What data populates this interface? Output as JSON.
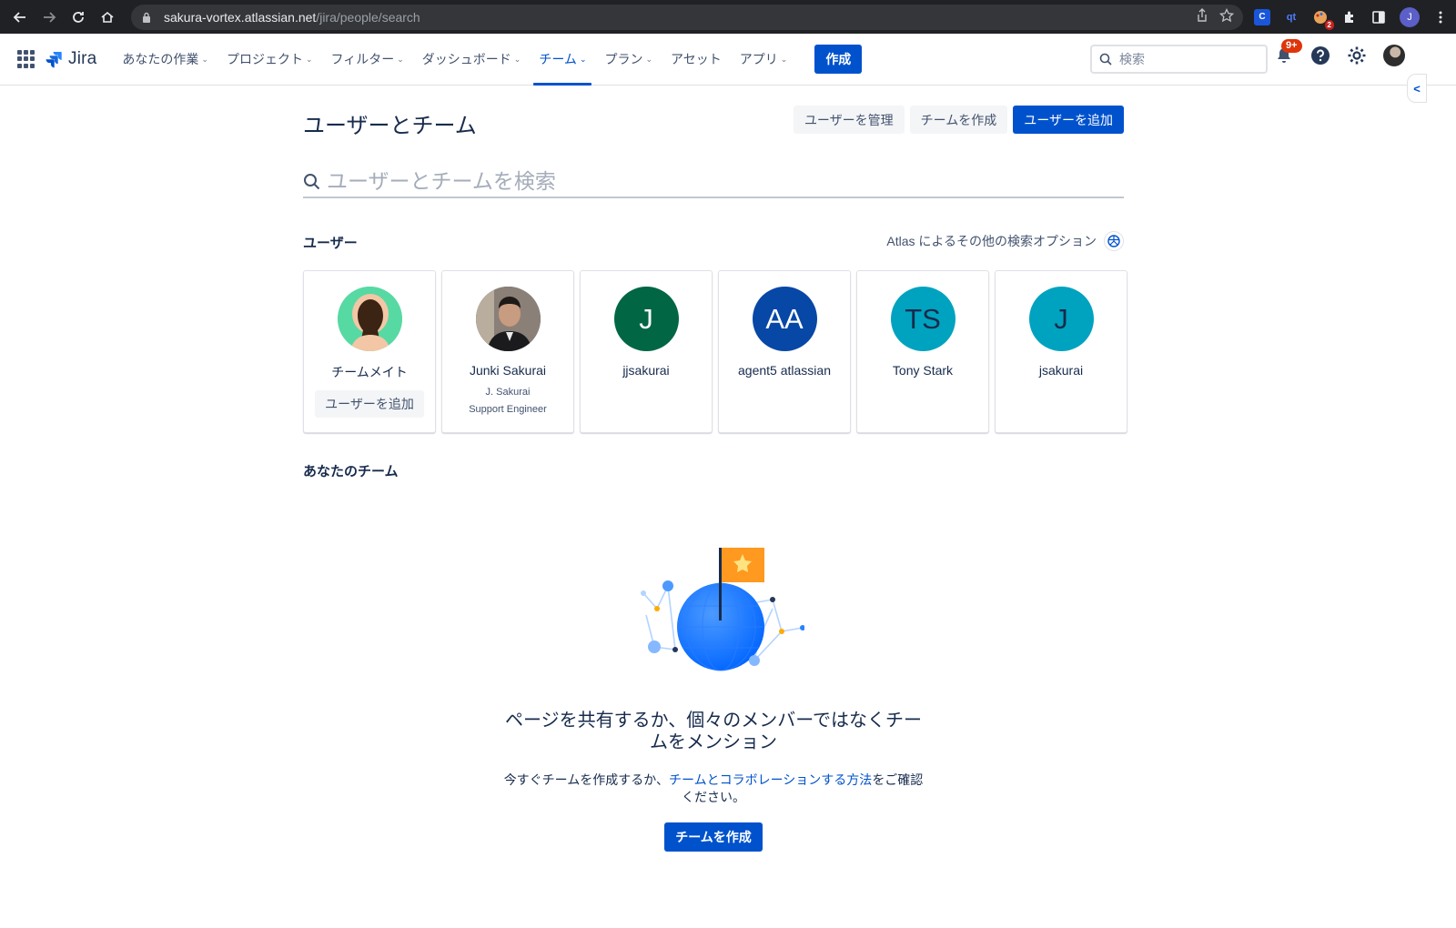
{
  "browser": {
    "url_host": "sakura-vortex.atlassian.net",
    "url_path": "/jira/people/search",
    "extensions": {
      "c_label": "C",
      "qt_label": "qt",
      "badge_count": "2"
    },
    "profile_initial": "J"
  },
  "topnav": {
    "logo_text": "Jira",
    "menu": [
      {
        "label": "あなたの作業"
      },
      {
        "label": "プロジェクト"
      },
      {
        "label": "フィルター"
      },
      {
        "label": "ダッシュボード"
      },
      {
        "label": "チーム"
      },
      {
        "label": "プラン"
      },
      {
        "label": "アセット"
      },
      {
        "label": "アプリ"
      }
    ],
    "create_label": "作成",
    "search_placeholder": "検索",
    "notifications_badge": "9+",
    "collapse_glyph": "<"
  },
  "page": {
    "title": "ユーザーとチーム",
    "actions": {
      "manage_users": "ユーザーを管理",
      "create_team": "チームを作成",
      "add_users": "ユーザーを追加"
    },
    "search_placeholder": "ユーザーとチームを検索"
  },
  "users_section": {
    "title": "ユーザー",
    "atlas_link": "Atlas によるその他の検索オプション",
    "cards": [
      {
        "name": "チームメイト",
        "add_label": "ユーザーを追加"
      },
      {
        "name": "Junki Sakurai",
        "sub1": "J. Sakurai",
        "sub2": "Support Engineer"
      },
      {
        "name": "jjsakurai",
        "initials": "J",
        "color": "#006644"
      },
      {
        "name": "agent5 atlassian",
        "initials": "AA",
        "color": "#0747a6"
      },
      {
        "name": "Tony Stark",
        "initials": "TS",
        "color": "#00a3bf"
      },
      {
        "name": "jsakurai",
        "initials": "J",
        "color": "#00a3bf"
      }
    ]
  },
  "teams_section": {
    "title": "あなたのチーム",
    "empty_title": "ページを共有するか、個々のメンバーではなくチームをメンション",
    "empty_desc_before": "今すぐチームを作成するか、",
    "empty_desc_link": "チームとコラボレーションする方法",
    "empty_desc_after": "をご確認ください。",
    "empty_button": "チームを作成"
  }
}
